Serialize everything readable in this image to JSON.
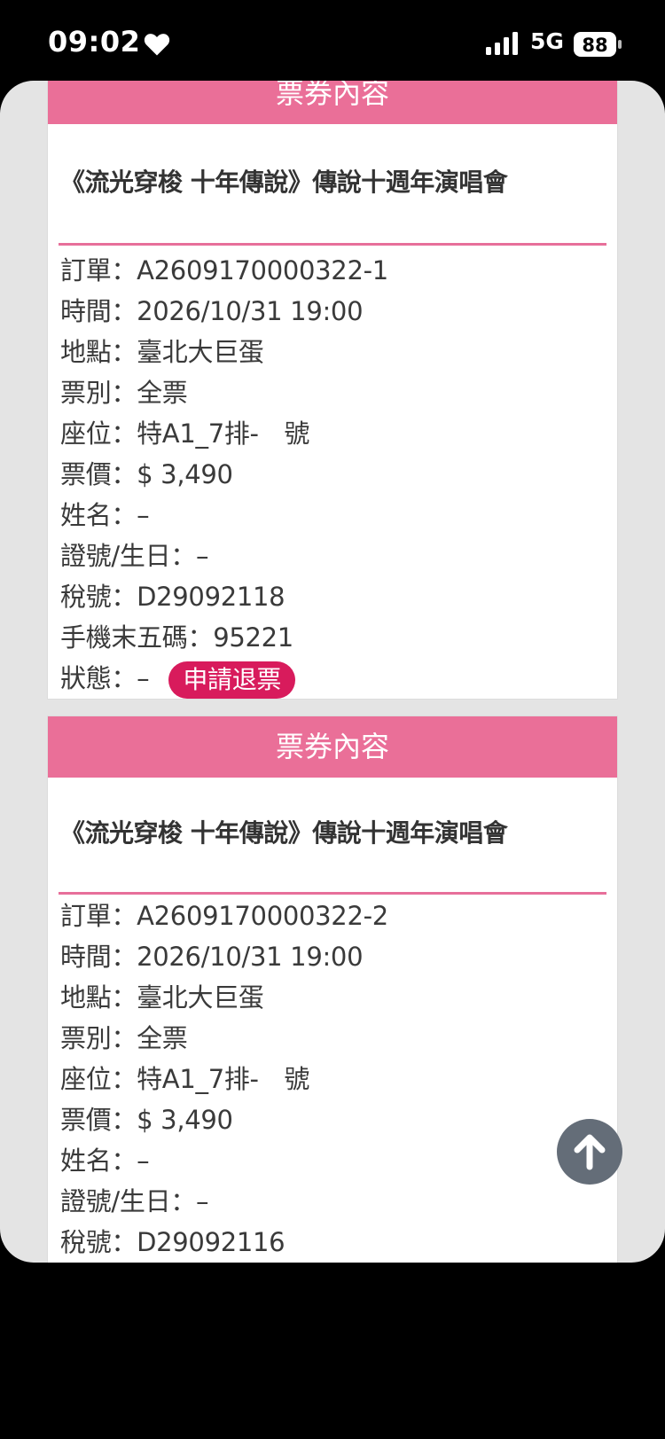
{
  "status_bar": {
    "time": "09:02",
    "network": "5G",
    "battery": "88"
  },
  "cards": [
    {
      "header": "票券內容",
      "title": "《流光穿梭 十年傳說》傳說十週年演唱會",
      "order": "訂單：A2609170000322-1",
      "time": "時間：2026/10/31 19:00",
      "venue": "地點：臺北大巨蛋",
      "type": "票別：全票",
      "seat": "座位：特A1_7排-　號",
      "price": "票價：$ 3,490",
      "name": "姓名：–",
      "id_birth": "證號/生日：–",
      "tax": "稅號：D29092118",
      "phone": "手機末五碼：95221",
      "status_label": "狀態：–",
      "refund_button": "申請退票"
    },
    {
      "header": "票券內容",
      "title": "《流光穿梭 十年傳說》傳說十週年演唱會",
      "order": "訂單：A2609170000322-2",
      "time": "時間：2026/10/31 19:00",
      "venue": "地點：臺北大巨蛋",
      "type": "票別：全票",
      "seat": "座位：特A1_7排-　號",
      "price": "票價：$ 3,490",
      "name": "姓名：–",
      "id_birth": "證號/生日：–",
      "tax": "稅號：D29092116"
    }
  ],
  "icons": {
    "scroll_top": "arrow-up-icon",
    "heart": "heart-icon"
  },
  "colors": {
    "header_pink": "#ea6f98",
    "refund_button": "#d81b5c",
    "divider": "#e76f9a"
  }
}
